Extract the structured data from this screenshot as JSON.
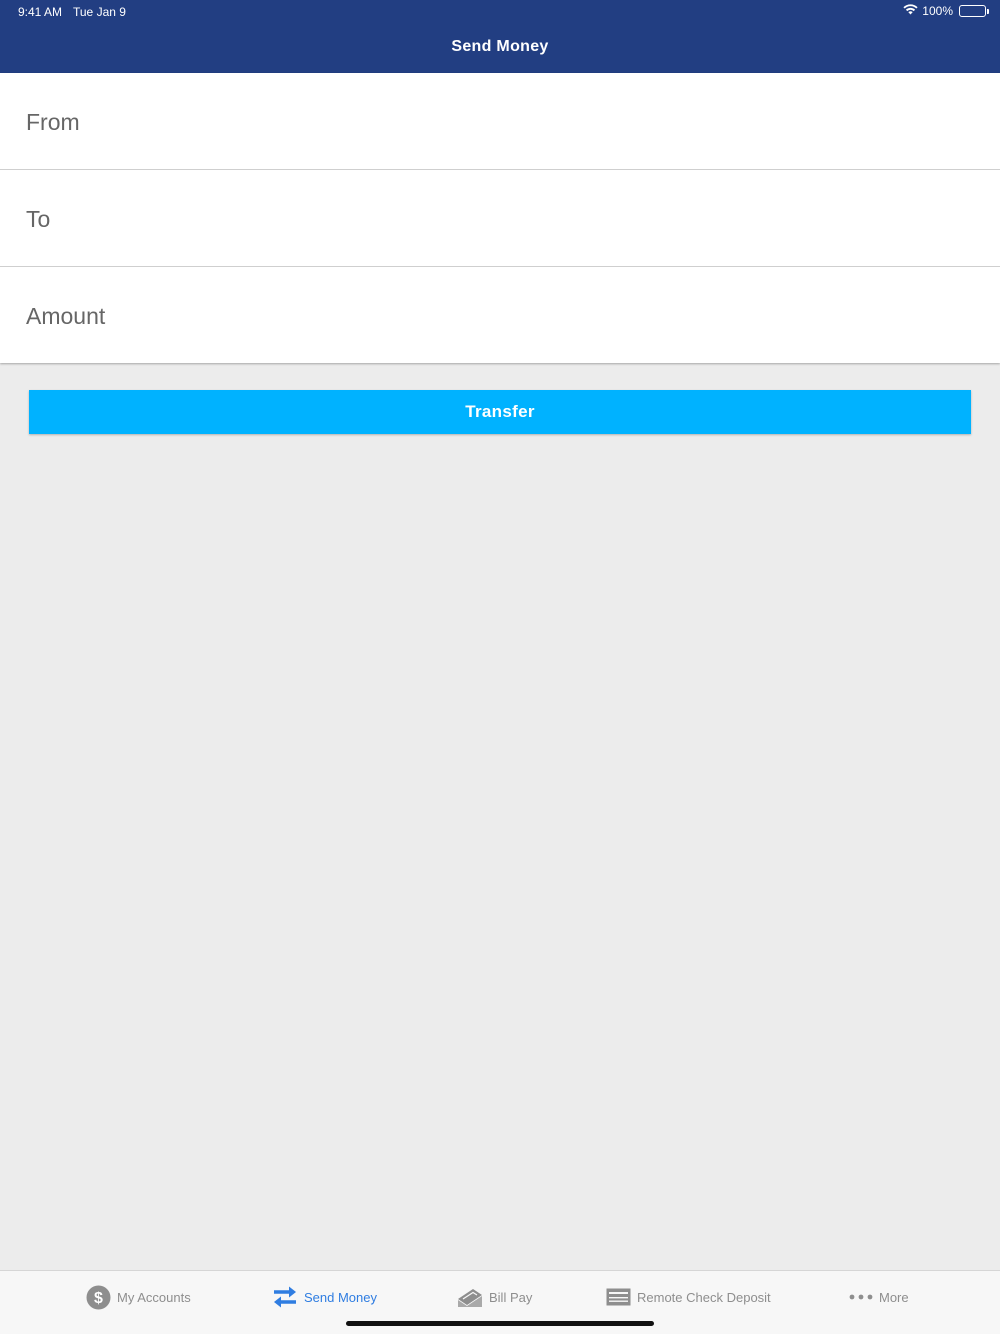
{
  "status_bar": {
    "time": "9:41 AM",
    "date": "Tue Jan 9",
    "battery": "100%",
    "icons": [
      "wifi-icon",
      "battery-icon"
    ]
  },
  "header": {
    "title": "Send Money",
    "background_color": "#223e82"
  },
  "form": {
    "fields": [
      {
        "label": "From",
        "value": ""
      },
      {
        "label": "To",
        "value": ""
      },
      {
        "label": "Amount",
        "value": ""
      }
    ],
    "submit_label": "Transfer",
    "submit_color": "#00b2ff"
  },
  "tab_bar": {
    "active_color": "#2f7de1",
    "inactive_color": "#8e8e8e",
    "tabs": [
      {
        "label": "My Accounts",
        "icon": "dollar-circle-icon",
        "active": false
      },
      {
        "label": "Send Money",
        "icon": "transfer-arrows-icon",
        "active": true
      },
      {
        "label": "Bill Pay",
        "icon": "bill-pay-icon",
        "active": false
      },
      {
        "label": "Remote Check Deposit",
        "icon": "check-icon",
        "active": false
      },
      {
        "label": "More",
        "icon": "more-dots-icon",
        "active": false
      }
    ]
  }
}
